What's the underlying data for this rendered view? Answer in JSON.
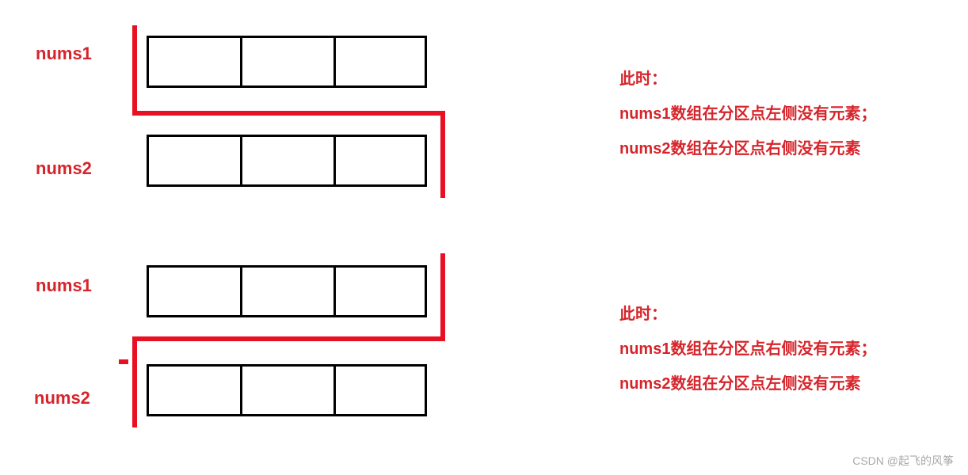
{
  "labels": {
    "nums1": "nums1",
    "nums2": "nums2"
  },
  "annotation_top": {
    "line1": "此时：",
    "line2": "nums1数组在分区点左侧没有元素；",
    "line3": "nums2数组在分区点右侧没有元素"
  },
  "annotation_bottom": {
    "line1": "此时：",
    "line2": "nums1数组在分区点右侧没有元素；",
    "line3": "nums2数组在分区点左侧没有元素"
  },
  "watermark": "CSDN @起飞的风筝",
  "colors": {
    "accent": "#e81123",
    "text": "#d6242a",
    "border": "#000000"
  },
  "diagram": {
    "array_cells": 3,
    "case1": {
      "description": "partition at left of nums1, right of nums2",
      "nums1_partition_index": 0,
      "nums2_partition_index": 3
    },
    "case2": {
      "description": "partition at right of nums1, left of nums2",
      "nums1_partition_index": 3,
      "nums2_partition_index": 0
    }
  }
}
